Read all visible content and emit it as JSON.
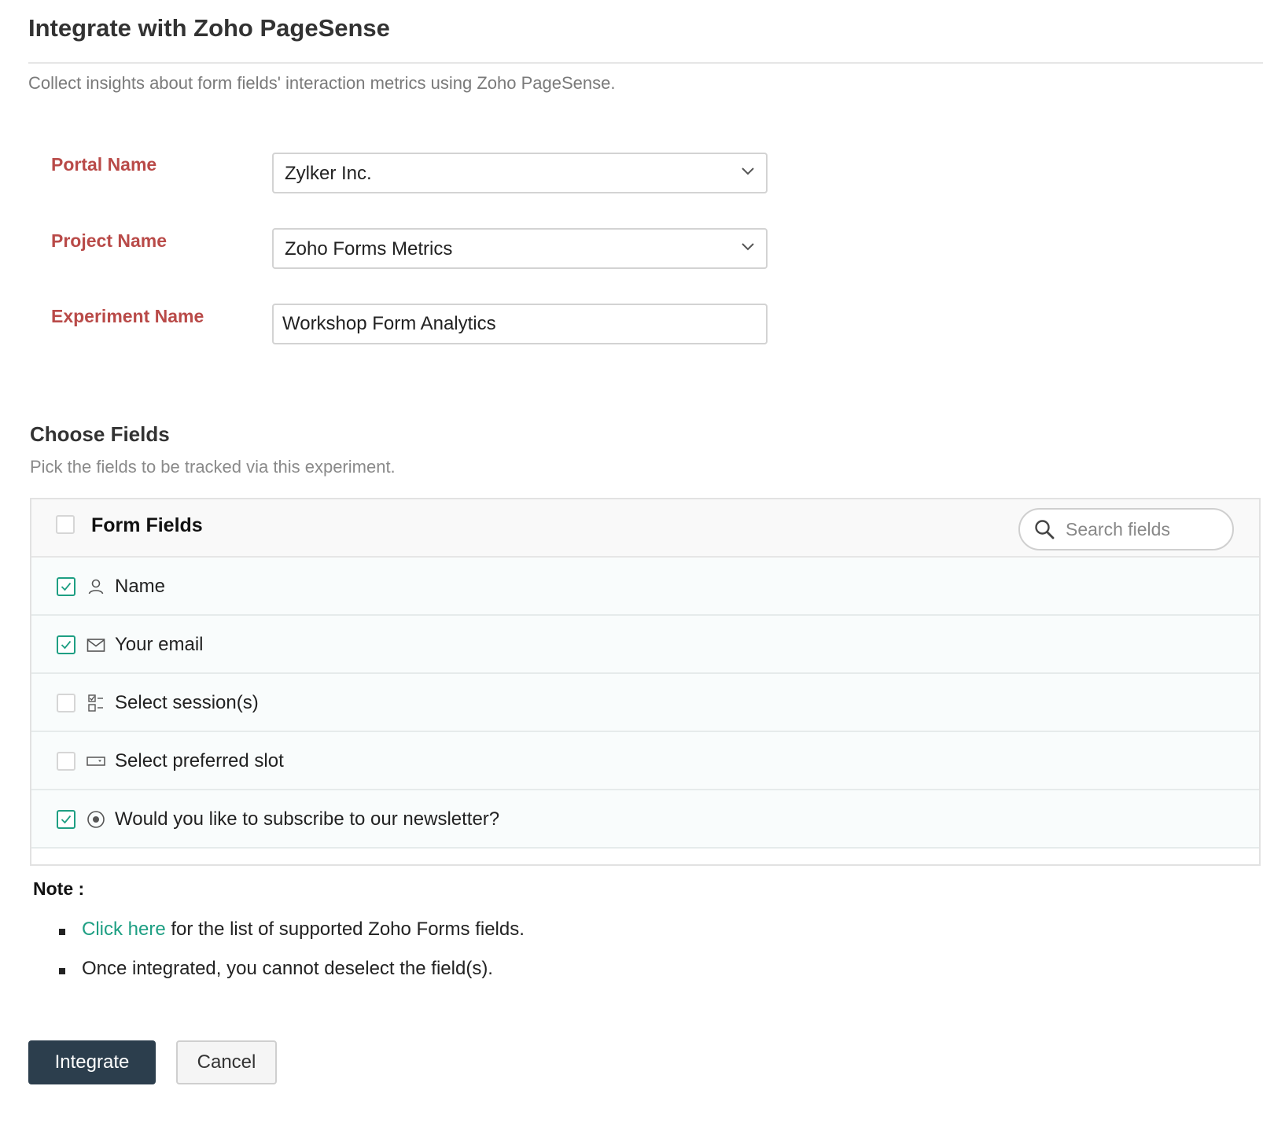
{
  "header": {
    "title": "Integrate with Zoho PageSense",
    "subtitle": "Collect insights about form fields' interaction metrics using Zoho PageSense."
  },
  "form": {
    "portal": {
      "label": "Portal Name",
      "value": "Zylker Inc."
    },
    "project": {
      "label": "Project Name",
      "value": "Zoho Forms Metrics"
    },
    "experiment": {
      "label": "Experiment Name",
      "value": "Workshop Form Analytics"
    }
  },
  "fields_section": {
    "title": "Choose Fields",
    "description": "Pick the fields to be tracked via this experiment.",
    "header_label": "Form Fields",
    "select_all_checked": false,
    "search_placeholder": "Search fields",
    "items": [
      {
        "label": "Name",
        "icon": "person-icon",
        "checked": true
      },
      {
        "label": "Your email",
        "icon": "email-icon",
        "checked": true
      },
      {
        "label": "Select session(s)",
        "icon": "checklist-icon",
        "checked": false
      },
      {
        "label": "Select preferred slot",
        "icon": "dropdown-field-icon",
        "checked": false
      },
      {
        "label": "Would you like to subscribe to our newsletter?",
        "icon": "radio-icon",
        "checked": true
      }
    ]
  },
  "note": {
    "title": "Note :",
    "link_text": "Click here",
    "item1_rest": " for the list of supported Zoho Forms fields.",
    "item2": "Once integrated, you cannot deselect the field(s)."
  },
  "actions": {
    "integrate_label": "Integrate",
    "cancel_label": "Cancel"
  },
  "colors": {
    "label_red": "#b94a48",
    "accent_green": "#1e9f83",
    "primary_button": "#2c3e4d"
  }
}
